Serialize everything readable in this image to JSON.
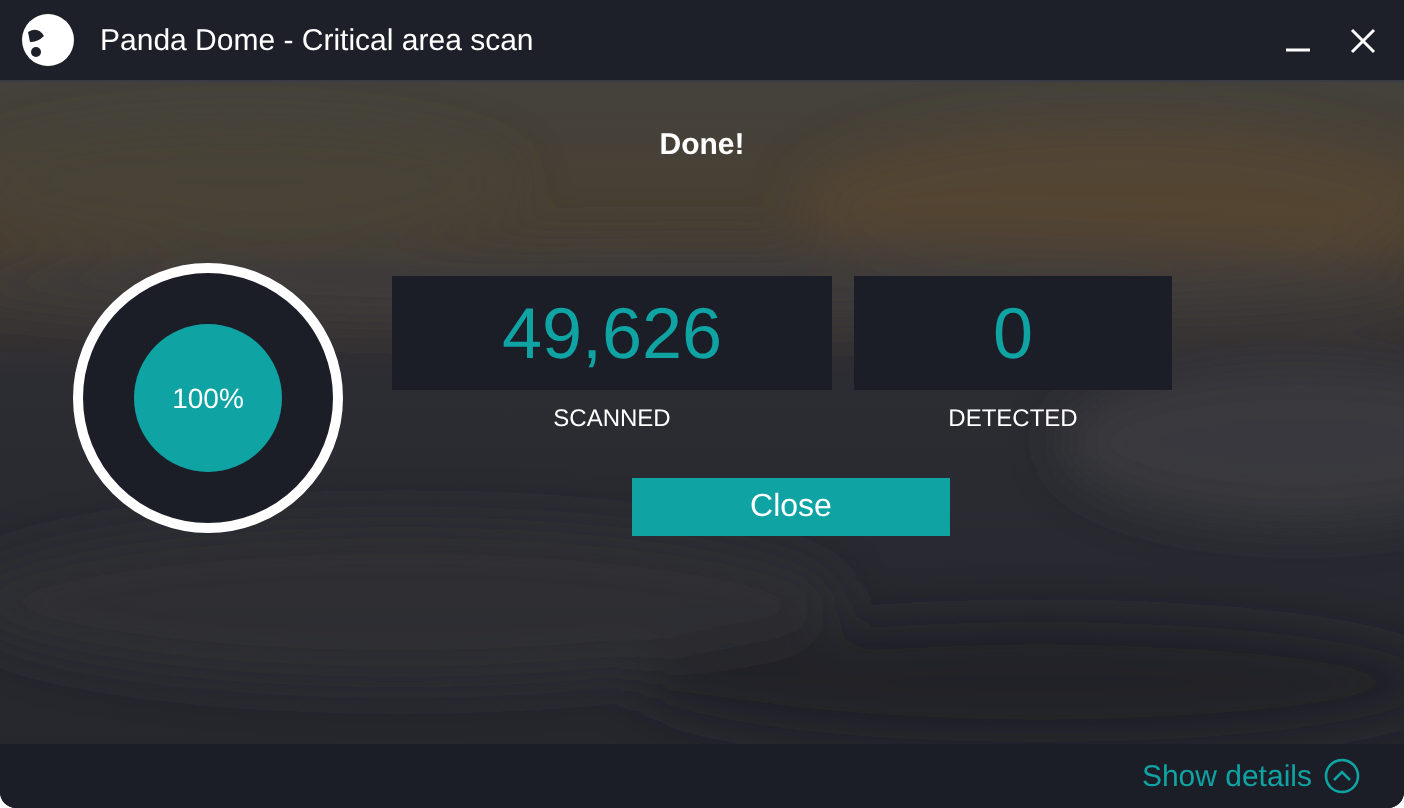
{
  "window": {
    "title": "Panda Dome - Critical area scan"
  },
  "status": "Done!",
  "progress": {
    "level": 1,
    "label": "100%"
  },
  "stats": [
    {
      "value": "49,626",
      "label": "SCANNED"
    },
    {
      "value": "0",
      "label": "DETECTED"
    }
  ],
  "buttons": [
    {
      "label": "Close"
    }
  ],
  "footer": {
    "link": "Show details"
  }
}
